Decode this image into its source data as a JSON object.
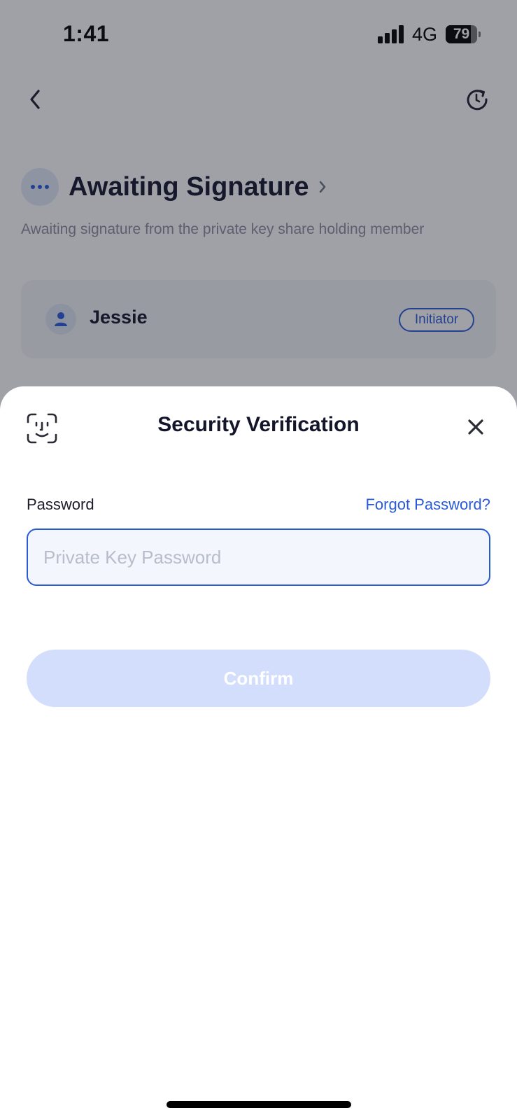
{
  "status_bar": {
    "time": "1:41",
    "network": "4G",
    "battery": "79",
    "battery_level_percent": 79
  },
  "header": {
    "back_icon": "chevron-left-icon",
    "refresh_icon": "refresh-icon"
  },
  "transaction": {
    "status_title": "Awaiting Signature",
    "status_description": "Awaiting signature from the private key share holding member",
    "members": [
      {
        "name": "Jessie",
        "tag": "Initiator"
      }
    ]
  },
  "sheet": {
    "title": "Security Verification",
    "face_id_icon": "face-id-icon",
    "close_icon": "close-icon",
    "password_label": "Password",
    "forgot_password": "Forgot Password?",
    "password_value": "",
    "password_placeholder": "Private Key Password",
    "confirm_label": "Confirm"
  },
  "colors": {
    "accent": "#2a5bd7",
    "confirm_disabled": "#d3defc",
    "overlay": "#1a1e2e"
  }
}
